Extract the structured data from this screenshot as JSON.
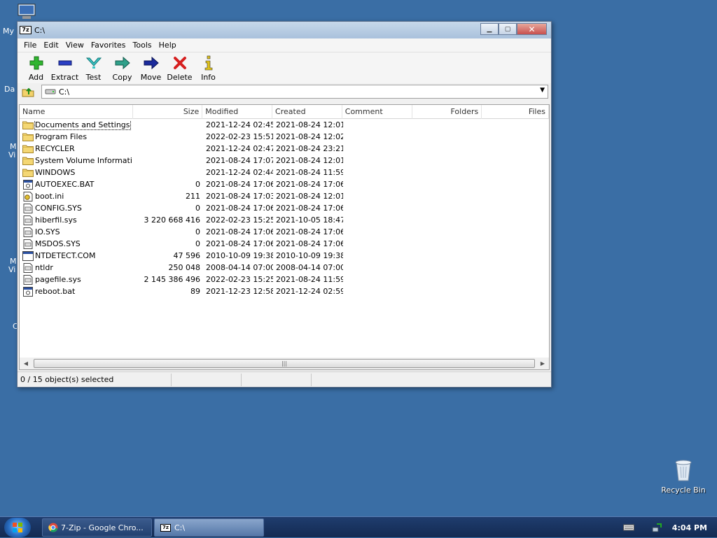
{
  "desktop": {
    "partials": [
      "My",
      "Da",
      "M",
      "Vi",
      "M",
      "Vi",
      "C"
    ],
    "recycle_bin": "Recycle Bin"
  },
  "window": {
    "title": "C:\\",
    "app_badge": "7z",
    "menu": [
      "File",
      "Edit",
      "View",
      "Favorites",
      "Tools",
      "Help"
    ],
    "toolbar": [
      "Add",
      "Extract",
      "Test",
      "Copy",
      "Move",
      "Delete",
      "Info"
    ],
    "address": "C:\\",
    "columns": [
      "Name",
      "Size",
      "Modified",
      "Created",
      "Comment",
      "Folders",
      "Files"
    ],
    "rows": [
      {
        "name": "Documents and Settings",
        "size": "",
        "modified": "2021-12-24 02:45",
        "created": "2021-08-24 12:01",
        "type": "folder"
      },
      {
        "name": "Program Files",
        "size": "",
        "modified": "2022-02-23 15:51",
        "created": "2021-08-24 12:02",
        "type": "folder"
      },
      {
        "name": "RECYCLER",
        "size": "",
        "modified": "2021-12-24 02:47",
        "created": "2021-08-24 23:21",
        "type": "folder"
      },
      {
        "name": "System Volume Informati...",
        "size": "",
        "modified": "2021-08-24 17:07",
        "created": "2021-08-24 12:01",
        "type": "folder"
      },
      {
        "name": "WINDOWS",
        "size": "",
        "modified": "2021-12-24 02:44",
        "created": "2021-08-24 11:59",
        "type": "folder"
      },
      {
        "name": "AUTOEXEC.BAT",
        "size": "0",
        "modified": "2021-08-24 17:06",
        "created": "2021-08-24 17:06",
        "type": "bat"
      },
      {
        "name": "boot.ini",
        "size": "211",
        "modified": "2021-08-24 17:03",
        "created": "2021-08-24 12:01",
        "type": "ini"
      },
      {
        "name": "CONFIG.SYS",
        "size": "0",
        "modified": "2021-08-24 17:06",
        "created": "2021-08-24 17:06",
        "type": "sys"
      },
      {
        "name": "hiberfil.sys",
        "size": "3 220 668 416",
        "modified": "2022-02-23 15:25",
        "created": "2021-10-05 18:47",
        "type": "sys"
      },
      {
        "name": "IO.SYS",
        "size": "0",
        "modified": "2021-08-24 17:06",
        "created": "2021-08-24 17:06",
        "type": "sys"
      },
      {
        "name": "MSDOS.SYS",
        "size": "0",
        "modified": "2021-08-24 17:06",
        "created": "2021-08-24 17:06",
        "type": "sys"
      },
      {
        "name": "NTDETECT.COM",
        "size": "47 596",
        "modified": "2010-10-09 19:38",
        "created": "2010-10-09 19:38",
        "type": "com"
      },
      {
        "name": "ntldr",
        "size": "250 048",
        "modified": "2008-04-14 07:00",
        "created": "2008-04-14 07:00",
        "type": "sys"
      },
      {
        "name": "pagefile.sys",
        "size": "2 145 386 496",
        "modified": "2022-02-23 15:25",
        "created": "2021-08-24 11:59",
        "type": "sys"
      },
      {
        "name": "reboot.bat",
        "size": "89",
        "modified": "2021-12-23 12:58",
        "created": "2021-12-24 02:59",
        "type": "bat"
      }
    ],
    "status": "0 / 15 object(s) selected"
  },
  "taskbar": {
    "items": [
      {
        "label": "7-Zip - Google Chro...",
        "active": false
      },
      {
        "label": "C:\\",
        "active": true
      }
    ],
    "clock": "4:04 PM"
  }
}
